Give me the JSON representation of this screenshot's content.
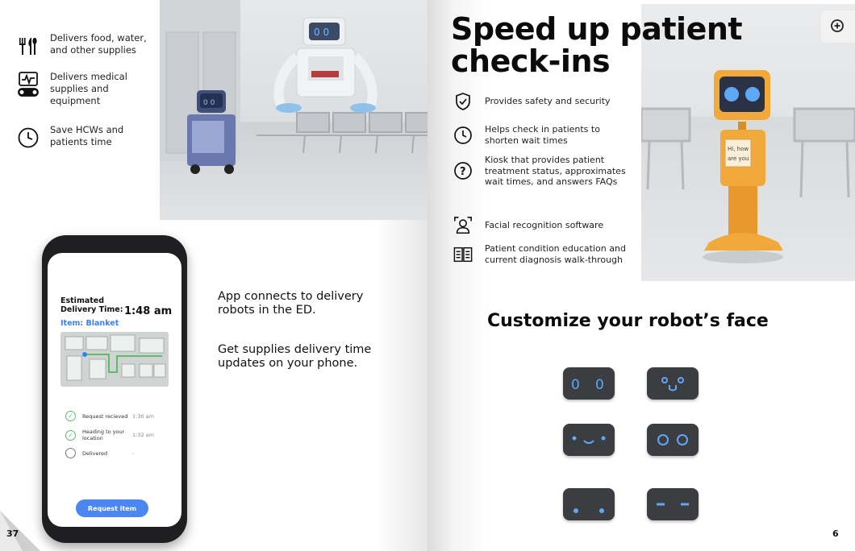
{
  "left_page": {
    "features": [
      {
        "icon": "utensils-icon",
        "text": "Delivers food, water, and other supplies"
      },
      {
        "icon": "medical-monitor-icon",
        "text": "Delivers medical supplies and equipment"
      },
      {
        "icon": "clock-icon",
        "text": "Save HCWs and patients time"
      }
    ],
    "phone": {
      "estimated_label": "Estimated Delivery Time:",
      "estimated_time": "1:48 am",
      "item": "Item: Blanket",
      "steps": [
        {
          "name": "Request recieved",
          "time": "1:30 am",
          "done": true
        },
        {
          "name": "Heading to your location",
          "time": "1:32 am",
          "done": true
        },
        {
          "name": "Delivered",
          "time": "-",
          "done": false
        }
      ],
      "button": "Request item"
    },
    "app_text_1": "App connects to delivery robots in the ED.",
    "app_text_2": "Get supplies delivery time updates on your phone.",
    "page_number": "37"
  },
  "right_page": {
    "title_line1": "Speed up patient",
    "title_line2": "check-ins",
    "features": [
      {
        "icon": "shield-check-icon",
        "text": "Provides safety and security"
      },
      {
        "icon": "clock-icon",
        "text": "Helps check in patients to shorten wait times"
      },
      {
        "icon": "question-icon",
        "text": "Kiosk that provides patient treatment status, approximates wait times, and answers FAQs"
      },
      {
        "icon": "face-scan-icon",
        "text": "Facial recognition software"
      },
      {
        "icon": "open-book-icon",
        "text": "Patient condition education and current diagnosis walk-through"
      }
    ],
    "robot_sign": "Hi, how are you",
    "customize_title": "Customize your robot’s face",
    "faces": [
      "face-1",
      "face-2",
      "face-3",
      "face-4",
      "face-5",
      "face-6"
    ],
    "page_number": "6"
  },
  "colors": {
    "accent_blue": "#4b86f1",
    "robot_yellow": "#f2a93b",
    "face_dark": "#3b3d40",
    "eye_blue": "#5fa8f5"
  }
}
